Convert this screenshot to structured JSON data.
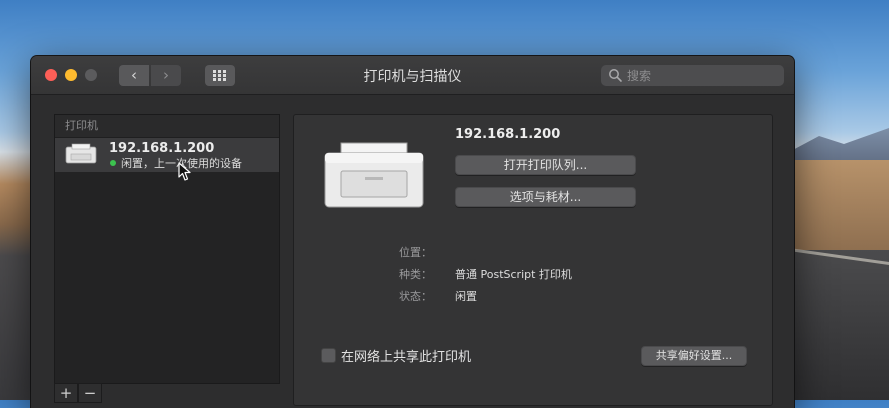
{
  "window": {
    "title": "打印机与扫描仪"
  },
  "toolbar": {
    "back_label": "‹",
    "forward_label": "›",
    "search_placeholder": "搜索"
  },
  "sidebar": {
    "header": "打印机",
    "printers": [
      {
        "name": "192.168.1.200",
        "status": "闲置，上一次使用的设备"
      }
    ],
    "add_label": "+",
    "remove_label": "−"
  },
  "detail": {
    "printer_name": "192.168.1.200",
    "open_queue_label": "打开打印队列...",
    "options_label": "选项与耗材...",
    "location_label": "位置：",
    "location_value": "",
    "kind_label": "种类：",
    "kind_value": "普通 PostScript 打印机",
    "status_label": "状态：",
    "status_value": "闲置",
    "share_label": "在网络上共享此打印机",
    "share_checked": false,
    "share_prefs_label": "共享偏好设置..."
  },
  "colors": {
    "close": "#fd5f57",
    "minimize": "#febb2f",
    "status_dot": "#3cc24f"
  }
}
